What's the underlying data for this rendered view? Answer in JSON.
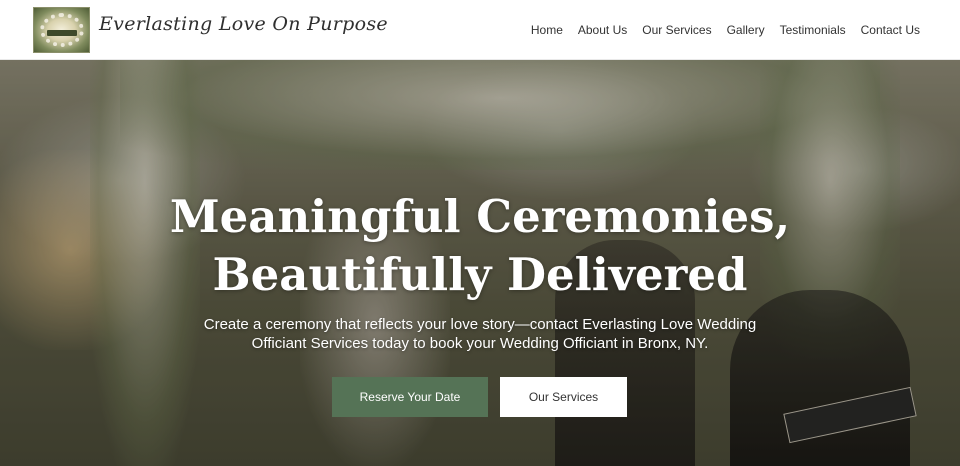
{
  "header": {
    "brand": "Everlasting Love On Purpose",
    "nav": [
      "Home",
      "About Us",
      "Our Services",
      "Gallery",
      "Testimonials",
      "Contact Us"
    ]
  },
  "hero": {
    "title_line1": "Meaningful Ceremonies,",
    "title_line2": "Beautifully Delivered",
    "subtitle_line1": "Create a ceremony that reflects your love story—contact Everlasting Love Wedding",
    "subtitle_line2": "Officiant Services today to book your Wedding Officiant in Bronx, NY.",
    "primary_button": "Reserve Your Date",
    "secondary_button": "Our Services"
  },
  "colors": {
    "accent_green": "#557356",
    "nav_text": "#333333",
    "white": "#ffffff"
  }
}
